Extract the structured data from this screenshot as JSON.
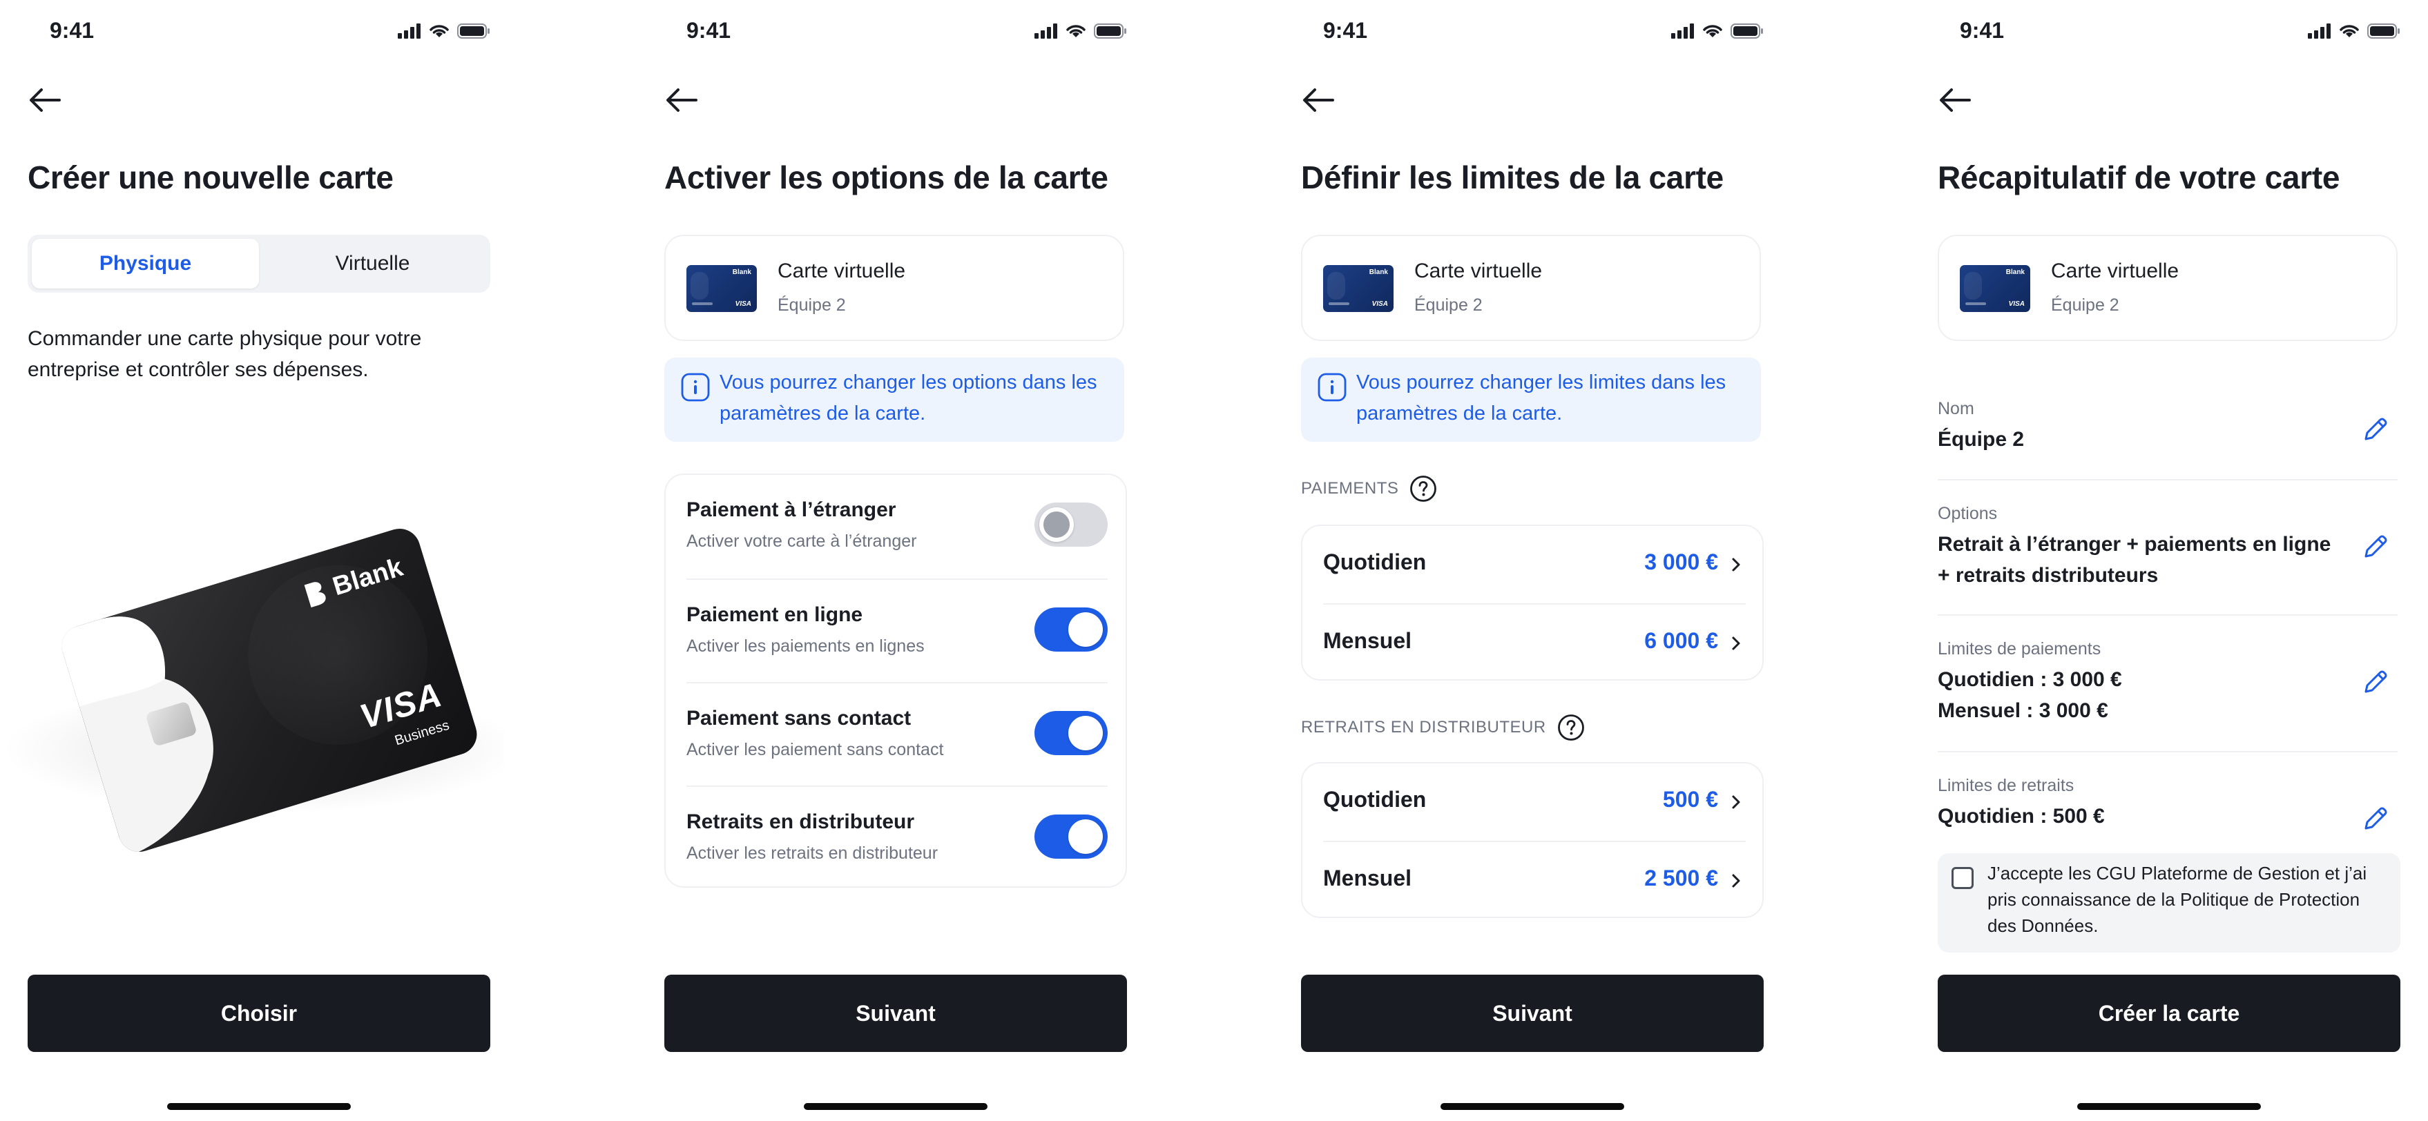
{
  "status_bar": {
    "time": "9:41"
  },
  "screen1": {
    "title": "Créer une nouvelle carte",
    "segments": [
      "Physique",
      "Virtuelle"
    ],
    "active_segment": "Physique",
    "description": "Commander une carte physique pour votre entreprise et contrôler ses dépenses.",
    "card": {
      "brand": "Blank",
      "network": "VISA",
      "network_sub": "Business"
    },
    "button": "Choisir"
  },
  "card_summary": {
    "name": "Carte virtuelle",
    "team": "Équipe 2",
    "brand": "Blank",
    "network": "VISA"
  },
  "screen2": {
    "title": "Activer les options de la carte",
    "info": "Vous pourrez changer les options dans les paramètres de la carte.",
    "options": [
      {
        "label": "Paiement à l’étranger",
        "sub": "Activer votre carte à l’étranger",
        "enabled": false
      },
      {
        "label": "Paiement en ligne",
        "sub": "Activer les paiements en lignes",
        "enabled": true
      },
      {
        "label": "Paiement sans contact",
        "sub": "Activer les paiement sans contact",
        "enabled": true
      },
      {
        "label": "Retraits en distributeur",
        "sub": "Activer les retraits en distributeur",
        "enabled": true
      }
    ],
    "button": "Suivant"
  },
  "screen3": {
    "title": "Définir les limites de la carte",
    "info": "Vous pourrez changer les limites dans les paramètres de la carte.",
    "payments": {
      "section": "PAIEMENTS",
      "rows": [
        {
          "label": "Quotidien",
          "value": "3 000 €"
        },
        {
          "label": "Mensuel",
          "value": "6 000 €"
        }
      ]
    },
    "withdrawals": {
      "section": "RETRAITS EN DISTRIBUTEUR",
      "rows": [
        {
          "label": "Quotidien",
          "value": "500 €"
        },
        {
          "label": "Mensuel",
          "value": "2 500 €"
        }
      ]
    },
    "button": "Suivant"
  },
  "screen4": {
    "title": "Récapitulatif de votre carte",
    "rows": [
      {
        "label": "Nom",
        "value": "Équipe 2"
      },
      {
        "label": "Options",
        "value": "Retrait à l’étranger + paiements en ligne + retraits distributeurs"
      },
      {
        "label": "Limites de paiements",
        "value": "Quotidien : 3 000 €",
        "value2": "Mensuel : 3 000 €"
      },
      {
        "label": "Limites de retraits",
        "value": "Quotidien : 500 €"
      }
    ],
    "terms": "J’accepte les CGU Plateforme de Gestion et j’ai pris connaissance de la Politique de Protection des Données.",
    "terms_checked": false,
    "button": "Créer la carte"
  },
  "colors": {
    "accent": "#1d5ce6",
    "button": "#181b22",
    "info_bg": "#eef4fd",
    "card": "#10285d"
  },
  "icons": [
    "back-arrow-icon",
    "signal-icon",
    "wifi-icon",
    "battery-icon",
    "info-icon",
    "help-icon",
    "chevron-right-icon",
    "pencil-icon"
  ]
}
